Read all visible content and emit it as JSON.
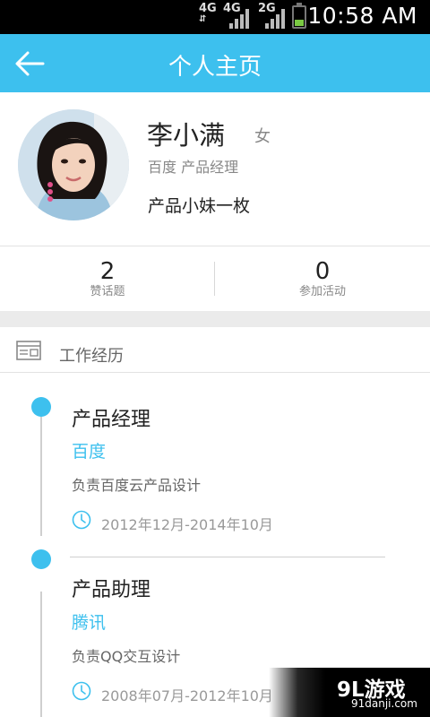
{
  "status_bar": {
    "time": "10:58 AM",
    "networks": [
      "4G",
      "4G",
      "2G"
    ],
    "icons": [
      "signal-icon",
      "battery-icon"
    ],
    "battery_level": 0.3,
    "battery_color": "#7ac943"
  },
  "header": {
    "title": "个人主页",
    "back_icon": "back-arrow-icon",
    "background_color": "#3dc0ee"
  },
  "profile": {
    "name": "李小满",
    "gender": "女",
    "company_role": "百度 产品经理",
    "bio": "产品小妹一枚"
  },
  "stats": [
    {
      "value": "2",
      "label": "赞话题"
    },
    {
      "value": "0",
      "label": "参加活动"
    }
  ],
  "section": {
    "icon": "resume-card-icon",
    "title": "工作经历"
  },
  "experiences": [
    {
      "title": "产品经理",
      "company": "百度",
      "description": "负责百度云产品设计",
      "period": "2012年12月-2014年10月"
    },
    {
      "title": "产品助理",
      "company": "腾讯",
      "description": "负责QQ交互设计",
      "period": "2008年07月-2012年10月"
    }
  ],
  "watermark": {
    "logo": "9L游戏",
    "url": "91danji.com"
  }
}
